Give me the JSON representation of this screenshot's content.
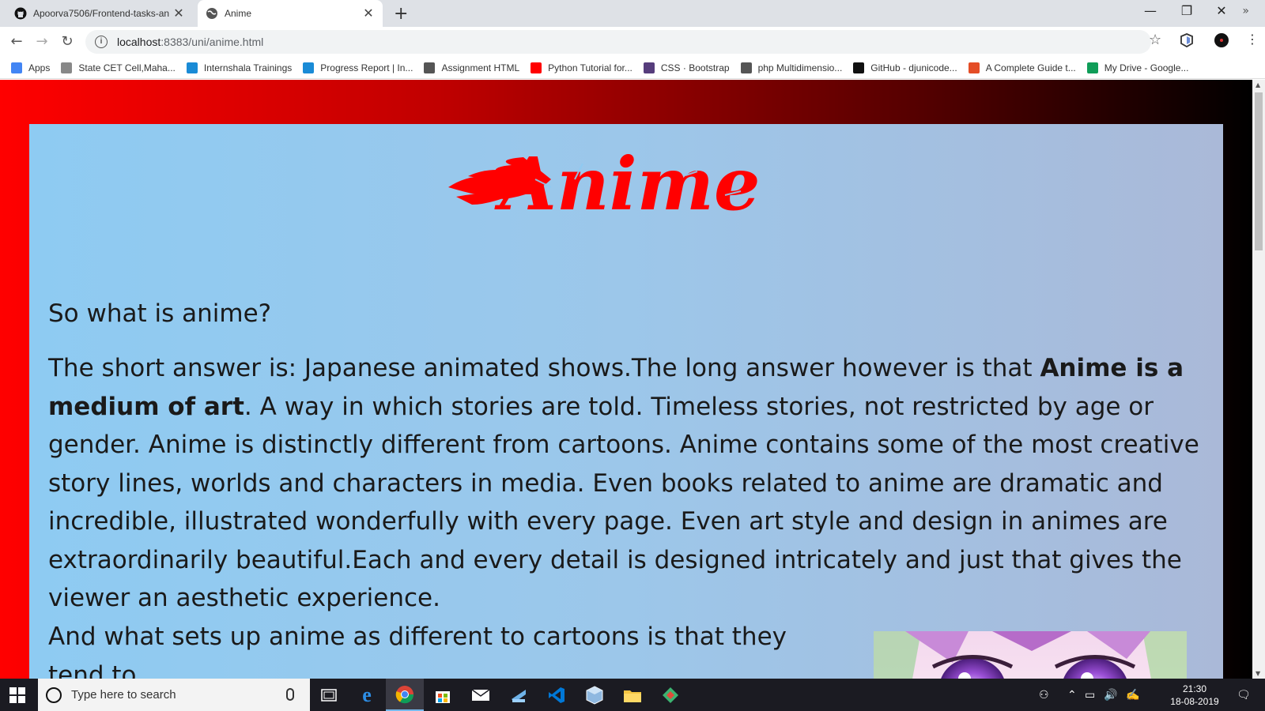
{
  "browser": {
    "tabs": [
      {
        "title": "Apoorva7506/Frontend-tasks-an",
        "icon": "github-icon"
      },
      {
        "title": "Anime",
        "icon": "globe-icon"
      }
    ],
    "url_host": "localhost",
    "url_path": ":8383/uni/anime.html",
    "bookmarks": [
      {
        "label": "Apps",
        "icon": "apps-grid-icon",
        "color": "#4285f4"
      },
      {
        "label": "State CET Cell,Maha...",
        "icon": "building-icon",
        "color": "#888888"
      },
      {
        "label": "Internshala Trainings",
        "icon": "internshala-icon",
        "color": "#1a8bd6"
      },
      {
        "label": "Progress Report | In...",
        "icon": "internshala-icon",
        "color": "#1a8bd6"
      },
      {
        "label": "Assignment HTML",
        "icon": "globe-icon",
        "color": "#555555"
      },
      {
        "label": "Python Tutorial for...",
        "icon": "youtube-icon",
        "color": "#ff0000"
      },
      {
        "label": "CSS · Bootstrap",
        "icon": "bootstrap-icon",
        "color": "#563d7c"
      },
      {
        "label": "php Multidimensio...",
        "icon": "globe-icon",
        "color": "#555555"
      },
      {
        "label": "GitHub - djunicode...",
        "icon": "github-icon",
        "color": "#111111"
      },
      {
        "label": "A Complete Guide t...",
        "icon": "guide-icon",
        "color": "#e44d26"
      },
      {
        "label": "My Drive - Google...",
        "icon": "drive-icon",
        "color": "#0f9d58"
      }
    ]
  },
  "page": {
    "logo_text": "Anime",
    "question": "So what is anime?",
    "para_part1": "The short answer is: Japanese animated shows.The long answer however is that ",
    "para_bold": "Anime is a medium of art",
    "para_part2": ". A way in which stories are told. Timeless stories, not restricted by age or gender. Anime is distinctly different from cartoons. Anime contains some of the most creative story lines, worlds and characters in media. Even books related to anime are dramatic and incredible, illustrated wonderfully with every page. Even art style and design in animes are extraordinarily beautiful.Each and every detail is designed intricately and just that gives the viewer an aesthetic experience.",
    "para2": "And what sets up anime as different to cartoons is that they tend to"
  },
  "taskbar": {
    "search_placeholder": "Type here to search",
    "time": "21:30",
    "date": "18-08-2019"
  },
  "colors": {
    "accent_red": "#ff0000",
    "card_blue": "#8ecbf2"
  }
}
